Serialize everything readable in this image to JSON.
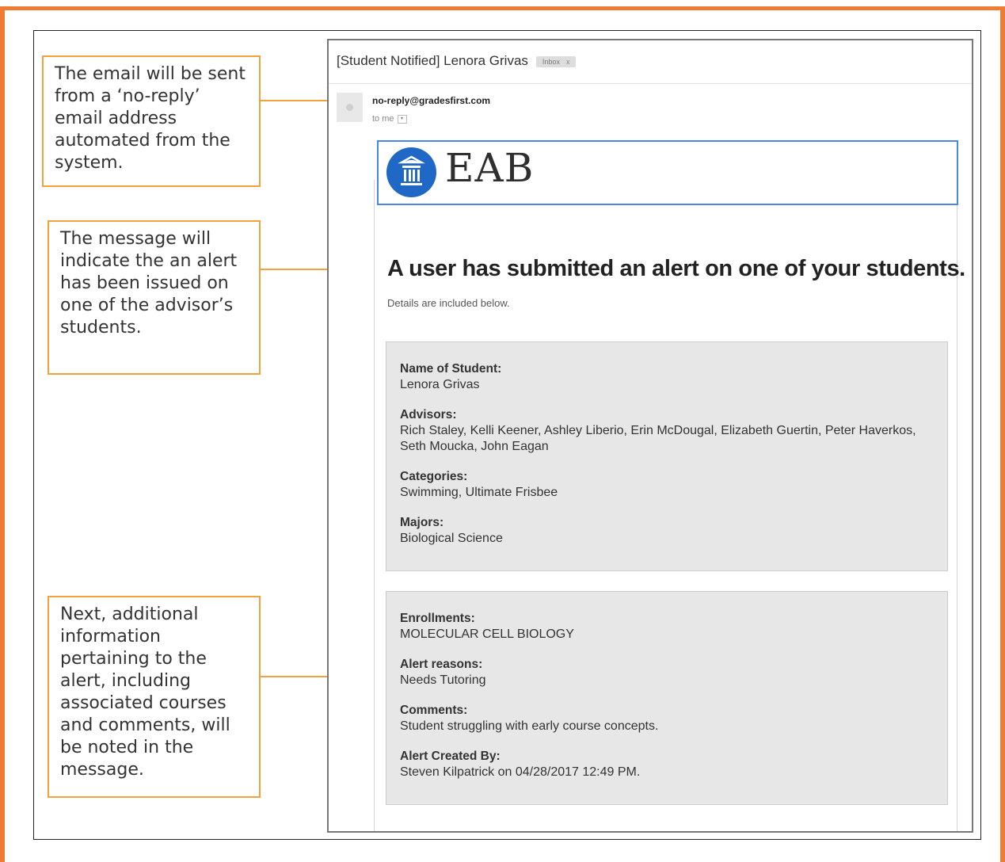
{
  "callouts": {
    "sender_note": "The email will be sent from a ‘no-reply’ email address automated from the system.",
    "message_note": "The message will indicate the an alert has been issued on one of the advisor’s students.",
    "details_note": "Next, additional information pertaining to the alert, including associated courses and comments, will be noted in the message."
  },
  "email": {
    "subject": "[Student Notified] Lenora Grivas",
    "inbox_tag": "Inbox",
    "inbox_tag_close": "x",
    "sender": "no-reply@gradesfirst.com",
    "recipient": "to me",
    "brand": "EAB",
    "headline": "A user has submitted an alert on one of your students.",
    "subline": "Details are included below.",
    "student_details": {
      "name_label": "Name of Student:",
      "name_value": "Lenora Grivas",
      "advisors_label": "Advisors:",
      "advisors_value": "Rich Staley, Kelli Keener, Ashley Liberio, Erin McDougal, Elizabeth Guertin, Peter Haverkos, Seth Moucka, John Eagan",
      "categories_label": "Categories:",
      "categories_value": "Swimming, Ultimate Frisbee",
      "majors_label": "Majors:",
      "majors_value": "Biological Science"
    },
    "alert_details": {
      "enrollments_label": "Enrollments:",
      "enrollments_value": "MOLECULAR CELL BIOLOGY",
      "reasons_label": "Alert reasons:",
      "reasons_value": "Needs Tutoring",
      "comments_label": "Comments:",
      "comments_value": "Student struggling with early course concepts.",
      "created_by_label": "Alert Created By:",
      "created_by_value": "Steven Kilpatrick on 04/28/2017 12:49 PM."
    }
  },
  "colors": {
    "frame_orange": "#ee7c32",
    "callout_orange": "#f2a23a",
    "eab_blue": "#1f68c5",
    "banner_border_blue": "#4a86e8"
  }
}
